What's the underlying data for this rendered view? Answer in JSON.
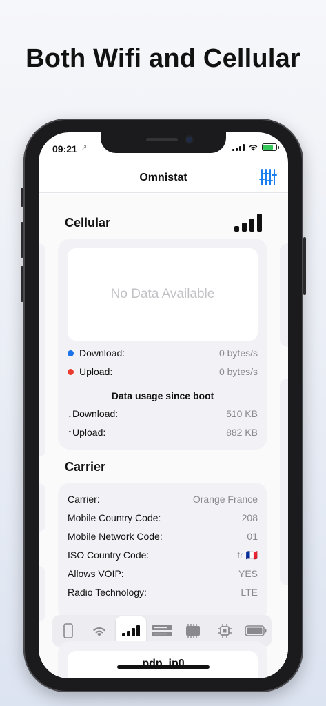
{
  "headline": "Both Wifi and Cellular",
  "status_bar": {
    "time": "09:21",
    "location_arrow": "↗",
    "battery_color": "#34c759"
  },
  "nav": {
    "title": "Omnistat",
    "settings_icon": "sliders-icon"
  },
  "cellular": {
    "title": "Cellular",
    "chart_placeholder": "No Data Available",
    "download_label": "Download:",
    "download_value": "0 bytes/s",
    "download_color": "#1a73e8",
    "upload_label": "Upload:",
    "upload_value": "0 bytes/s",
    "upload_color": "#ea3b2e",
    "since_boot_title": "Data usage since boot",
    "boot_download_label": "↓Download:",
    "boot_download_value": "510 KB",
    "boot_upload_label": "↑Upload:",
    "boot_upload_value": "882 KB"
  },
  "carrier": {
    "title": "Carrier",
    "rows": [
      {
        "label": "Carrier:",
        "value": "Orange France"
      },
      {
        "label": "Mobile Country Code:",
        "value": "208"
      },
      {
        "label": "Mobile Network Code:",
        "value": "01"
      },
      {
        "label": "ISO Country Code:",
        "value": "fr 🇫🇷"
      },
      {
        "label": "Allows VOIP:",
        "value": "YES"
      },
      {
        "label": "Radio Technology:",
        "value": "LTE"
      }
    ]
  },
  "tabs": [
    "phone-icon",
    "wifi-icon",
    "cellular-icon",
    "storage-icon",
    "memory-icon",
    "cpu-icon",
    "battery-icon"
  ],
  "bottom_card_text": "pdp_ip0"
}
